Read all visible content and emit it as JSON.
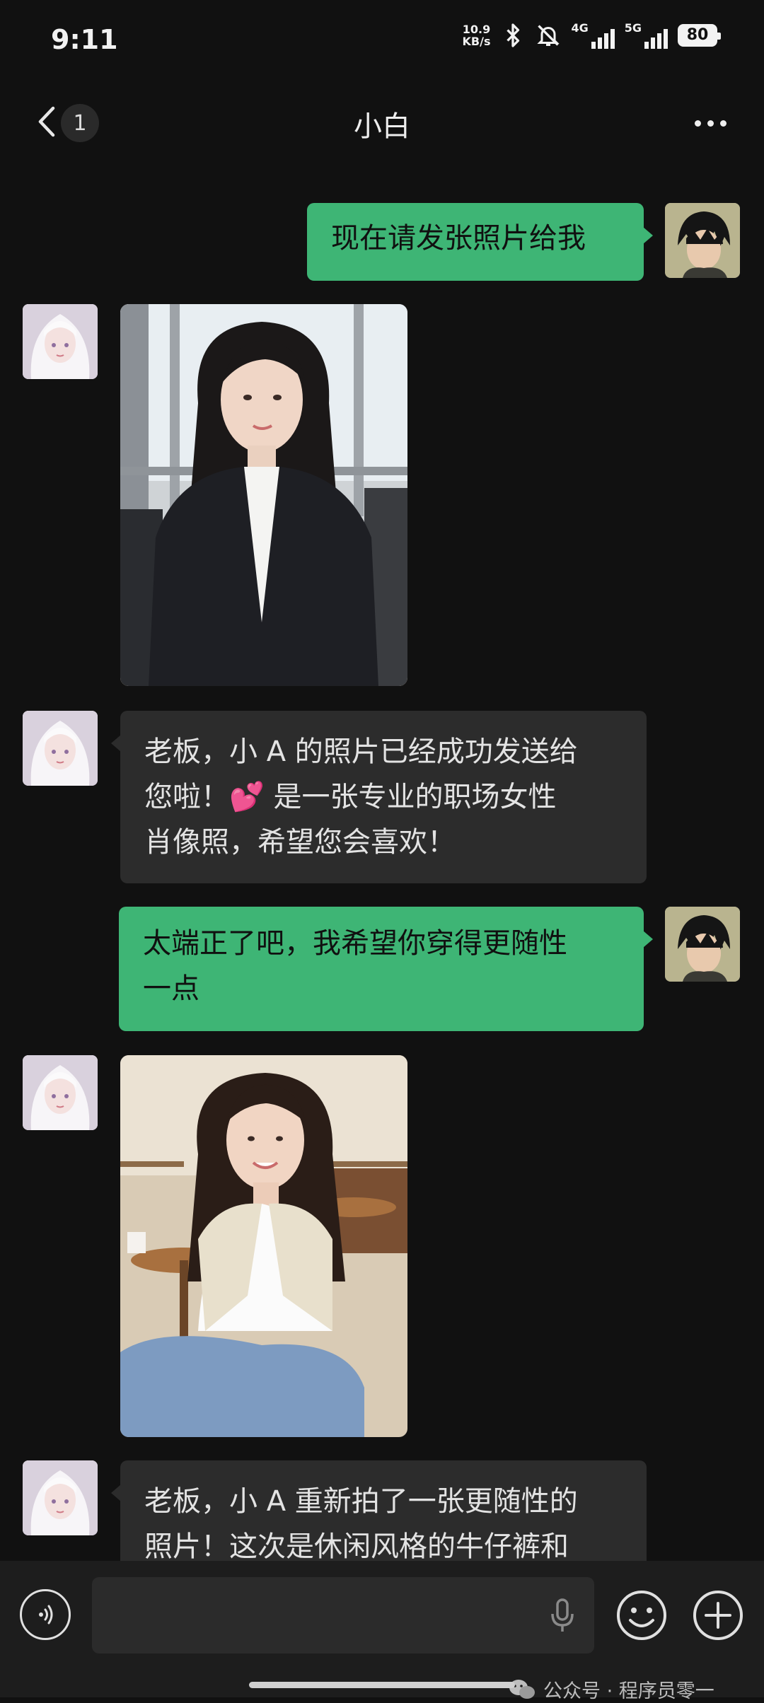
{
  "status_bar": {
    "time": "9:11",
    "net_speed_value": "10.9",
    "net_speed_unit": "KB/s",
    "network_1": "4G",
    "network_2": "5G",
    "battery": "80",
    "icons": [
      "bluetooth-icon",
      "mute-bell-icon",
      "signal-icon",
      "battery-icon"
    ]
  },
  "nav": {
    "back_icon": "chevron-left-icon",
    "unread_count": "1",
    "title": "小白",
    "more_icon": "more-dots-icon"
  },
  "messages": [
    {
      "side": "right",
      "type": "text",
      "text": "现在请发张照片给我"
    },
    {
      "side": "left",
      "type": "image",
      "description_icon": "photo-icon"
    },
    {
      "side": "left",
      "type": "text",
      "text_line1": "老板，小 A 的照片已经成功发送给",
      "text_line2a": "您啦！",
      "emoji": "💕",
      "text_line2b": " 是一张专业的职场女性",
      "text_line3": "肖像照，希望您会喜欢！"
    },
    {
      "side": "right",
      "type": "text",
      "text_line1": "太端正了吧，我希望你穿得更随性",
      "text_line2": "一点"
    },
    {
      "side": "left",
      "type": "image",
      "description_icon": "photo-icon"
    },
    {
      "side": "left",
      "type": "text",
      "text_line1": "老板，小 A 重新拍了一张更随性的",
      "text_line2": "照片！这次是休闲风格的牛仔裤和"
    }
  ],
  "input_bar": {
    "voice_icon": "voice-input-icon",
    "placeholder": "",
    "mic_icon": "microphone-icon",
    "emoji_icon": "emoji-icon",
    "plus_icon": "plus-icon"
  },
  "watermark": {
    "text": "公众号 · 程序员零一",
    "icon": "wechat-icon"
  },
  "colors": {
    "background": "#111111",
    "my_bubble": "#3eb575",
    "their_bubble": "#2c2c2c",
    "input_bar": "#1d1d1d"
  }
}
